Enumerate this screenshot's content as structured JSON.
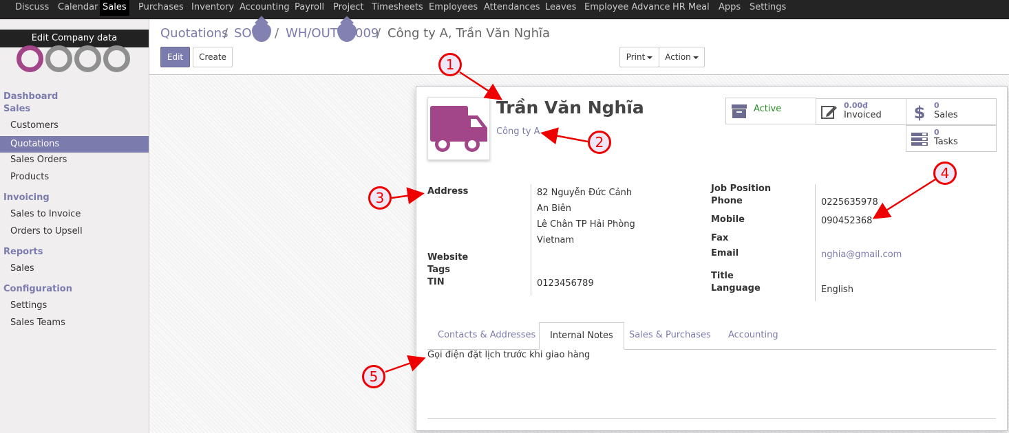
{
  "topmenu": {
    "items": [
      "Discuss",
      "Calendar",
      "Sales",
      "Purchases",
      "Inventory",
      "Accounting",
      "Payroll",
      "Project",
      "Timesheets",
      "Employees",
      "Attendances",
      "Leaves",
      "Employee Advance",
      "HR Meal",
      "Apps",
      "Settings"
    ],
    "active": "Sales"
  },
  "sidebar": {
    "edit_company": "Edit Company data",
    "dashboard": "Dashboard",
    "sections": [
      {
        "title": "Sales",
        "items": [
          "Customers",
          "Quotations",
          "Sales Orders",
          "Products"
        ]
      },
      {
        "title": "Invoicing",
        "items": [
          "Sales to Invoice",
          "Orders to Upsell"
        ]
      },
      {
        "title": "Reports",
        "items": [
          "Sales"
        ]
      },
      {
        "title": "Configuration",
        "items": [
          "Settings",
          "Sales Teams"
        ]
      }
    ],
    "active_item": "Quotations"
  },
  "breadcrumb": {
    "items": [
      "Quotations",
      "SO",
      "WH/OUT",
      "009"
    ],
    "current": "Công ty A, Trần Văn Nghĩa",
    "sep": "/"
  },
  "buttons": {
    "edit": "Edit",
    "create": "Create",
    "print": "Print",
    "action": "Action"
  },
  "partner": {
    "name": "Trần Văn Nghĩa",
    "company": "Công ty A",
    "avatar_icon": "truck-icon",
    "avatar_color": "#a24689"
  },
  "stat_buttons": {
    "active": "Active",
    "invoiced_value": "0.00₫",
    "invoiced_label": "Invoiced",
    "sales_value": "0",
    "sales_label": "Sales",
    "tasks_value": "0",
    "tasks_label": "Tasks"
  },
  "fields_left": {
    "address_label": "Address",
    "address_lines": [
      "82 Nguyễn Đức Cảnh",
      "An Biên",
      "Lê Chân TP Hải Phòng",
      "Vietnam"
    ],
    "website_label": "Website",
    "tags_label": "Tags",
    "tin_label": "TIN",
    "tin_value": "0123456789"
  },
  "fields_right": {
    "job_label": "Job Position",
    "phone_label": "Phone",
    "phone_value": "0225635978",
    "mobile_label": "Mobile",
    "mobile_value": "090452368",
    "fax_label": "Fax",
    "email_label": "Email",
    "email_value": "nghia@gmail.com",
    "title_label": "Title",
    "language_label": "Language",
    "language_value": "English"
  },
  "tabs": {
    "items": [
      "Contacts & Addresses",
      "Internal Notes",
      "Sales & Purchases",
      "Accounting"
    ],
    "active": "Internal Notes"
  },
  "notes": "Gọi điện đặt lịch trước khi giao hàng",
  "callouts": [
    "1",
    "2",
    "3",
    "4",
    "5"
  ],
  "colors": {
    "accent": "#7c7bad",
    "callout": "#e00000",
    "active_green": "#2a8a2a"
  }
}
